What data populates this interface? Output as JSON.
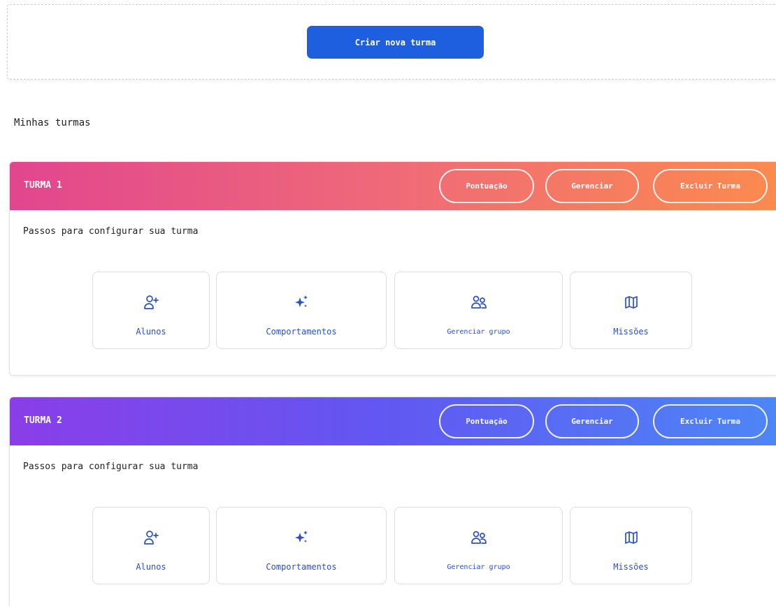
{
  "create": {
    "button_label": "Criar nova turma"
  },
  "section": {
    "title": "Minhas turmas"
  },
  "turmas": [
    {
      "name": "TURMA 1",
      "actions": {
        "score": "Pontuação",
        "manage": "Gerenciar",
        "delete": "Excluir Turma"
      },
      "steps_label": "Passos para configurar sua turma",
      "steps": [
        {
          "label": "Alunos",
          "icon": "user-plus-icon"
        },
        {
          "label": "Comportamentos",
          "icon": "sparkles-icon"
        },
        {
          "label": "Gerenciar grupo",
          "icon": "users-icon"
        },
        {
          "label": "Missões",
          "icon": "map-icon"
        }
      ],
      "header_gradient": [
        "#e2468e",
        "#ef6a78",
        "#fc8a4e"
      ]
    },
    {
      "name": "TURMA 2",
      "actions": {
        "score": "Pontuação",
        "manage": "Gerenciar",
        "delete": "Excluir Turma"
      },
      "steps_label": "Passos para configurar sua turma",
      "steps": [
        {
          "label": "Alunos",
          "icon": "user-plus-icon"
        },
        {
          "label": "Comportamentos",
          "icon": "sparkles-icon"
        },
        {
          "label": "Gerenciar grupo",
          "icon": "users-icon"
        },
        {
          "label": "Missões",
          "icon": "map-icon"
        }
      ],
      "header_gradient": [
        "#8a3ee8",
        "#6158f2",
        "#4d86f6"
      ]
    }
  ],
  "colors": {
    "primary": "#1e5fe0",
    "step_text": "#2b50c4"
  }
}
